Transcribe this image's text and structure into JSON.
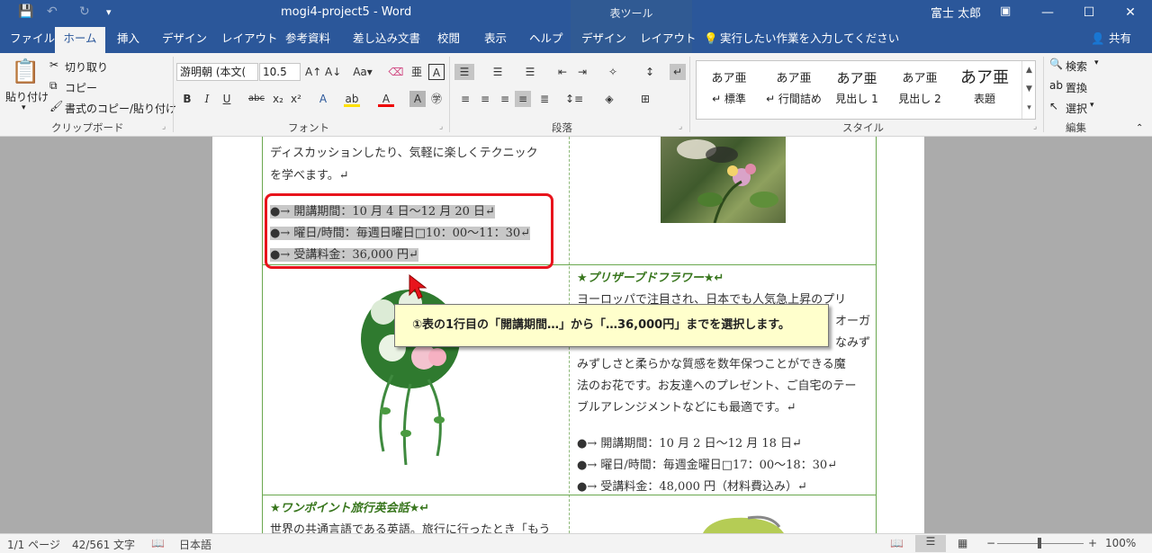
{
  "title_bar": {
    "doc_title": "mogi4-project5  -  Word",
    "context_group": "表ツール",
    "user": "富士 太郎"
  },
  "tabs": [
    "ファイル",
    "ホーム",
    "挿入",
    "デザイン",
    "レイアウト",
    "参考資料",
    "差し込み文書",
    "校閲",
    "表示",
    "ヘルプ",
    "デザイン",
    "レイアウト"
  ],
  "tell_me": "実行したい作業を入力してください",
  "share": "共有",
  "clipboard": {
    "paste": "貼り付け",
    "cut": "切り取り",
    "copy": "コピー",
    "format_painter": "書式のコピー/貼り付け",
    "label": "クリップボード"
  },
  "font": {
    "name": "游明朝 (本文(",
    "size": "10.5",
    "label": "フォント"
  },
  "paragraph": {
    "label": "段落"
  },
  "styles": {
    "items": [
      {
        "preview": "あア亜",
        "name": "↵ 標準"
      },
      {
        "preview": "あア亜",
        "name": "↵ 行間詰め"
      },
      {
        "preview": "あア亜",
        "name": "見出し 1"
      },
      {
        "preview": "あア亜",
        "name": "見出し 2"
      },
      {
        "preview": "あア亜",
        "name": "表題"
      }
    ],
    "label": "スタイル"
  },
  "editing": {
    "find": "検索",
    "replace": "置換",
    "select": "選択",
    "label": "編集"
  },
  "document": {
    "cell1_lines": [
      "ディスカッションしたり、気軽に楽しくテクニック",
      "を学べます。↵"
    ],
    "bullets1": [
      "●→ 開講期間：10 月 4 日～12 月 20 日↵",
      "●→ 曜日/時間：毎週日曜日□10：00～11：30↵",
      "●→ 受講料金：36,000 円↵"
    ],
    "heading2": "★プリザーブドフラワー★↵",
    "cell2_lines": [
      "ヨーロッパで注目され、日本でも人気急上昇のプリ",
      "オーガ",
      "なみず",
      "みずしさと柔らかな質感を数年保つことができる魔",
      "法のお花です。お友達へのプレゼント、ご自宅のテー",
      "ブルアレンジメントなどにも最適です。↵"
    ],
    "bullets2": [
      "●→ 開講期間：10 月 2 日～12 月 18 日↵",
      "●→ 曜日/時間：毎週金曜日□17：00～18：30↵",
      "●→ 受講料金：48,000 円（材料費込み）↵"
    ],
    "heading3": "★ワンポイント旅行英会話★↵",
    "cell3_line": "世界の共通言語である英語。旅行に行ったとき「もう"
  },
  "callout": "①表の1行目の「開講期間…」から「…36,000円」までを選択します。",
  "status": {
    "page": "1/1 ページ",
    "words": "42/561 文字",
    "lang": "日本語",
    "zoom": "100%"
  }
}
